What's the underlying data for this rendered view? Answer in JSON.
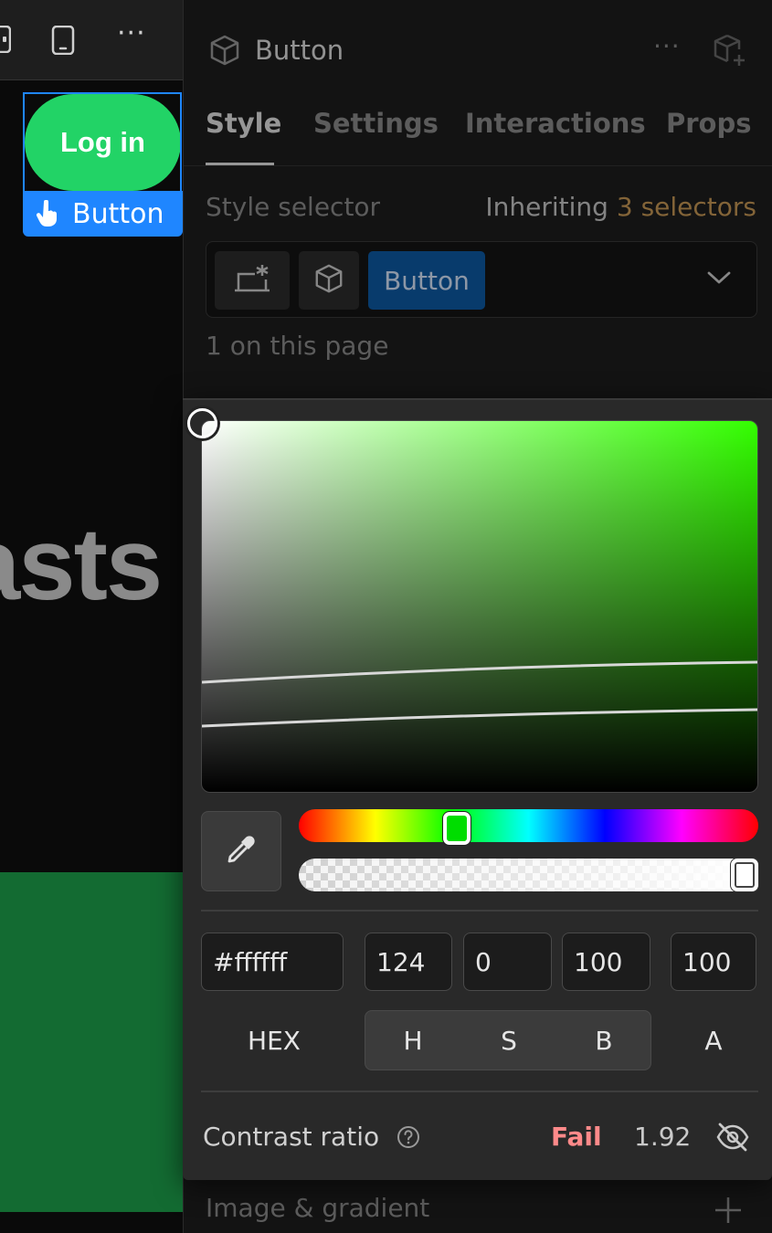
{
  "canvas": {
    "selected_element_text": "Log in",
    "selection_tag_label": "Button",
    "heading_fragment": "asts",
    "colors": {
      "button_bg": "#22d366",
      "selection": "#1f86ff",
      "green_block": "#136b32"
    }
  },
  "panel": {
    "title": "Button",
    "tabs": [
      {
        "label": "Style",
        "active": true
      },
      {
        "label": "Settings",
        "active": false
      },
      {
        "label": "Interactions",
        "active": false
      },
      {
        "label": "Props",
        "active": false
      }
    ],
    "style_selector_label": "Style selector",
    "inheriting_prefix": "Inheriting",
    "inheriting_count": "3 selectors",
    "selector_chip_label": "Button",
    "on_page_text": "1 on this page",
    "image_gradient_label": "Image & gradient"
  },
  "picker": {
    "hue": 124,
    "hex_value": "#ffffff",
    "h_value": "124",
    "s_value": "0",
    "b_value": "100",
    "a_value": "100",
    "modes": {
      "hex": "HEX",
      "h": "H",
      "s": "S",
      "b": "B",
      "a": "A"
    },
    "contrast_label": "Contrast ratio",
    "contrast_status": "Fail",
    "contrast_value": "1.92",
    "colors": {
      "fail": "#ff8a8a",
      "accent": "#c99a56"
    }
  },
  "icons": [
    "cube-icon",
    "device-phone-icon",
    "more-icon",
    "add-component-icon",
    "global-selector-icon",
    "chevron-down-icon",
    "eyedropper-icon",
    "help-icon",
    "eye-off-icon",
    "plus-icon",
    "hand-pointer-icon"
  ]
}
